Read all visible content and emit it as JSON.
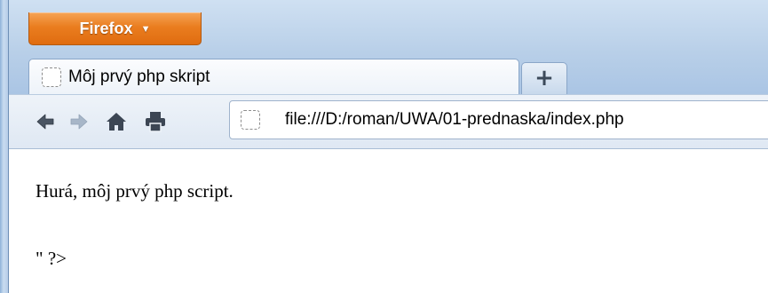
{
  "firefox_menu": {
    "label": "Firefox",
    "caret": "▼"
  },
  "tabs": [
    {
      "title": "Môj prvý php skript",
      "icon": "page-icon",
      "active": true
    }
  ],
  "new_tab": {
    "label": "+"
  },
  "toolbar": {
    "icons": [
      "back-arrow-icon",
      "forward-arrow-icon",
      "home-icon",
      "print-icon"
    ]
  },
  "address_bar": {
    "icon": "page-icon",
    "url": "file:///D:/roman/UWA/01-prednaska/index.php"
  },
  "page_content": {
    "line1": "Hurá, môj prvý php script.",
    "line2": "\" ?>"
  },
  "colors": {
    "firefox_button": "#e97a1c",
    "chrome_blue": "#b8cfe8",
    "content_bg": "#ffffff"
  }
}
